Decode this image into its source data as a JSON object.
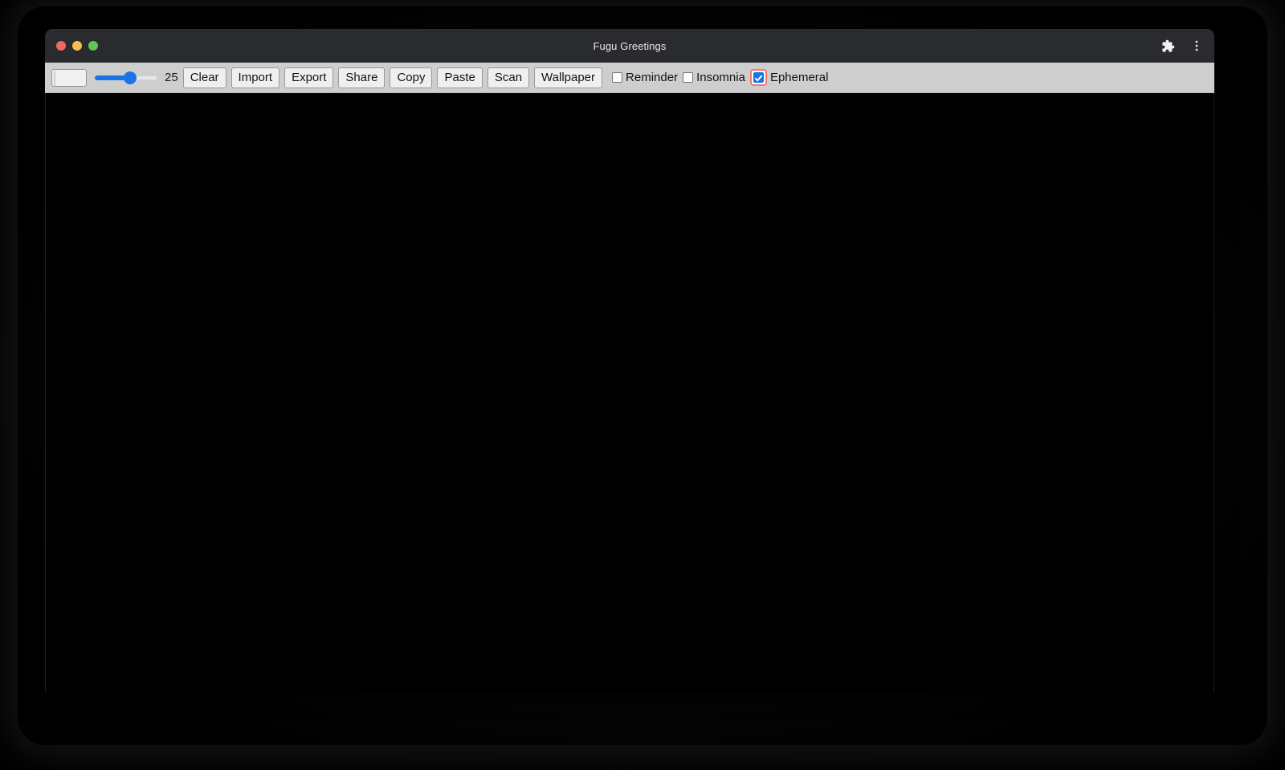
{
  "window": {
    "title": "Fugu Greetings",
    "traffic_lights": [
      {
        "name": "close",
        "color": "#ed6a5e"
      },
      {
        "name": "minimize",
        "color": "#f5bf4f"
      },
      {
        "name": "maximize",
        "color": "#61c554"
      }
    ],
    "titlebar_icons": [
      {
        "name": "extensions-icon",
        "glyph": "puzzle"
      },
      {
        "name": "chrome-menu-icon",
        "glyph": "three-dots-vertical"
      }
    ],
    "background_color": "#2a2b2f"
  },
  "toolbar": {
    "color_picker": {
      "label": "color-picker",
      "value": "#fdfdfd"
    },
    "slider": {
      "label": "pen-size-slider",
      "value": 25,
      "min": 1,
      "max": 50,
      "value_text": "25",
      "fill_color": "#1a73e8"
    },
    "buttons": [
      {
        "name": "clear-button",
        "label": "Clear"
      },
      {
        "name": "import-button",
        "label": "Import"
      },
      {
        "name": "export-button",
        "label": "Export"
      },
      {
        "name": "share-button",
        "label": "Share"
      },
      {
        "name": "copy-button",
        "label": "Copy"
      },
      {
        "name": "paste-button",
        "label": "Paste"
      },
      {
        "name": "scan-button",
        "label": "Scan"
      },
      {
        "name": "wallpaper-button",
        "label": "Wallpaper"
      }
    ],
    "checkboxes": [
      {
        "name": "reminder-checkbox",
        "label": "Reminder",
        "checked": false,
        "focused": false
      },
      {
        "name": "insomnia-checkbox",
        "label": "Insomnia",
        "checked": false,
        "focused": false
      },
      {
        "name": "ephemeral-checkbox",
        "label": "Ephemeral",
        "checked": true,
        "focused": true
      }
    ],
    "background_color": "#cecece"
  },
  "canvas": {
    "name": "drawing-canvas",
    "background_color": "#000000",
    "content": ""
  }
}
